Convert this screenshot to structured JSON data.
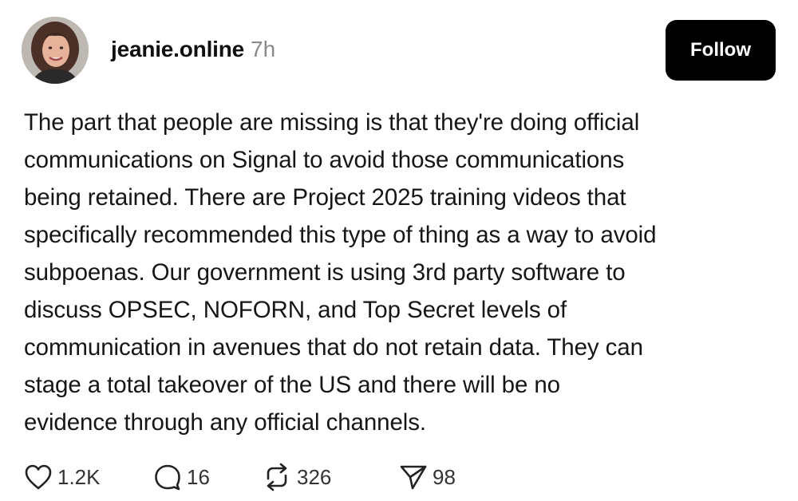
{
  "post": {
    "username": "jeanie.online",
    "timestamp": "7h",
    "follow_label": "Follow",
    "body_lines": [
      "The part that people are missing is that they're doing official",
      "communications on Signal to avoid those communications",
      "being retained. There are Project 2025 training videos that",
      "specifically recommended this type of thing as a way to avoid",
      "subpoenas. Our government is using 3rd party software to",
      "discuss OPSEC, NOFORN, and Top Secret levels of",
      "communication in avenues that do not retain data. They can",
      "stage a total takeover of the US and there will be no",
      "evidence through any official channels."
    ]
  },
  "actions": {
    "likes": "1.2K",
    "comments": "16",
    "reposts": "326",
    "shares": "98"
  },
  "icons": {
    "like": "heart-icon",
    "comment": "comment-bubble-icon",
    "repost": "repost-icon",
    "share": "share-icon",
    "avatar": "profile-photo"
  },
  "colors": {
    "follow_button_bg": "#000000",
    "follow_button_text": "#ffffff",
    "timestamp": "#8a8a8a",
    "text": "#161616"
  }
}
